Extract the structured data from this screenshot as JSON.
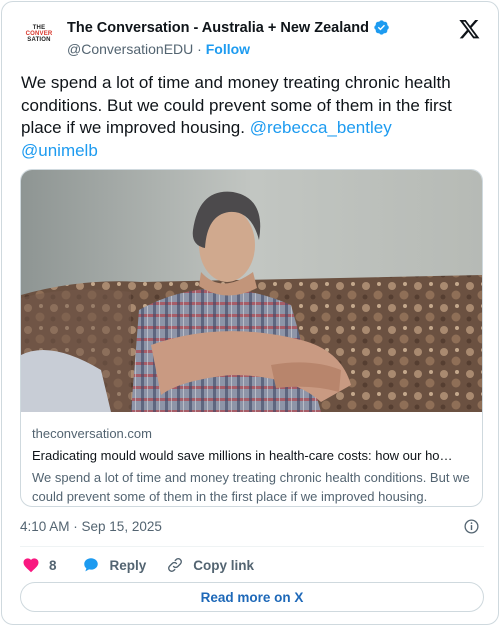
{
  "author": {
    "name": "The Conversation - Australia + New Zealand",
    "handle": "@ConversationEDU",
    "separator": "·",
    "follow_label": "Follow",
    "avatar_text": [
      "THE",
      "CONVER",
      "SATION"
    ],
    "verified_icon": "verified-badge-icon",
    "platform_icon": "x-logo-icon"
  },
  "tweet": {
    "text": "We spend a lot of time and money treating chronic health conditions. But we could prevent some of them in the first place if we improved housing. ",
    "mentions": [
      "@rebecca_bentley",
      "@unimelb"
    ]
  },
  "link_card": {
    "domain": "theconversation.com",
    "title": "Eradicating mould would save millions in health-care costs: how our ho…",
    "description": "We spend a lot of time and money treating chronic health conditions. But we could prevent some of them in the first place if we improved housing."
  },
  "meta": {
    "timestamp": "4:10 AM · Sep 15, 2025"
  },
  "actions": {
    "like_count": "8",
    "reply_label": "Reply",
    "copy_label": "Copy link"
  },
  "read_more_label": "Read more on X",
  "colors": {
    "accent": "#1d9bf0",
    "like": "#f91880",
    "text": "#0f1419",
    "muted": "#536471",
    "border": "#cfd9de"
  }
}
